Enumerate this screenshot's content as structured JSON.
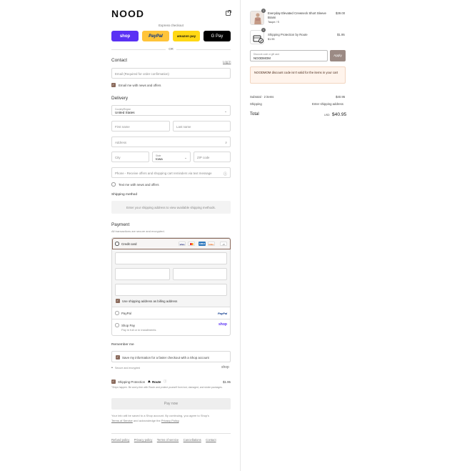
{
  "brand": {
    "logo": "NOOD"
  },
  "express": {
    "label": "Express checkout",
    "buttons": [
      {
        "label": "shop",
        "color": "#5a31f4",
        "text_color": "#ffffff"
      },
      {
        "label": "PayPal",
        "color": "#ffc439",
        "text_color": "#003087"
      },
      {
        "label": "amazon pay",
        "color": "#ffd814",
        "text_color": "#111111"
      },
      {
        "label": "G Pay",
        "color": "#000000",
        "text_color": "#ffffff"
      }
    ],
    "or_label": "OR"
  },
  "contact": {
    "heading": "Contact",
    "login_link": "Log in",
    "email_placeholder": "Email (Required for order confirmation)",
    "news_checkbox_label": "Email me with news and offers"
  },
  "delivery": {
    "heading": "Delivery",
    "country_label": "Country/Region",
    "country_value": "United States",
    "first_name_placeholder": "First name",
    "last_name_placeholder": "Last name",
    "address_placeholder": "Address",
    "city_placeholder": "City",
    "state_label": "State",
    "state_value": "Iowa",
    "zip_placeholder": "ZIP code",
    "phone_placeholder": "Phone - Receive offers and shopping cart reminders via text message",
    "text_checkbox_label": "Text me with news and offers"
  },
  "shipping_method": {
    "heading": "Shipping method",
    "message": "Enter your shipping address to view available shipping methods."
  },
  "payment": {
    "heading": "Payment",
    "subtitle": "All transactions are secure and encrypted.",
    "credit_card_label": "Credit card",
    "card_brands": [
      "VISA",
      "MC",
      "AMEX",
      "DISC"
    ],
    "more_cards": "+5",
    "billing_checkbox_label": "Use shipping address as billing address",
    "paypal_label": "PayPal",
    "paypal_logo": "PayPal",
    "shoppay_label": "Shop Pay",
    "shoppay_sub": "Pay in full or in installments",
    "shoppay_logo": "shop"
  },
  "remember": {
    "heading": "Remember me",
    "checkbox_label": "Save my information for a faster checkout with a Shop account",
    "secure_label": "Secure and encrypted",
    "shop_logo": "shop"
  },
  "protection": {
    "label": "Shipping Protection",
    "route_label": "Route",
    "price": "$1.95",
    "description": "\"Ships happen. Be worry-free with Route and protect yourself from lost, damaged, and stolen packages."
  },
  "pay_now_label": "Pay now",
  "legal": {
    "line1": "Your info will be saved to a Shop account. By continuing, you agree to Shop's",
    "terms_link": "Terms of Service",
    "middle": "and acknowledge the",
    "privacy_link": "Privacy Policy",
    "end": "."
  },
  "footer_links": [
    "Refund policy",
    "Privacy policy",
    "Terms of service",
    "Cancellations",
    "Contact"
  ],
  "summary": {
    "items": [
      {
        "qty": "1",
        "name": "Everyday Elevated Crewneck Short Sleeve Brami",
        "variant": "Taupe / S",
        "price": "$39.00"
      },
      {
        "qty": "1",
        "name": "Shipping Protection by Route",
        "variant": "$1.95",
        "price": "$1.95"
      }
    ],
    "discount_label": "Discount code or gift card",
    "discount_value": "NOODMOM",
    "apply_label": "Apply",
    "error_message": "NOODMOM discount code isn't valid for the items in your cart",
    "subtotal_label": "Subtotal · 2 items",
    "subtotal_value": "$40.95",
    "shipping_label": "Shipping",
    "shipping_value": "Enter shipping address",
    "total_label": "Total",
    "currency": "USD",
    "total_value": "$40.95",
    "colors": {
      "accent": "#8a6a5c",
      "error_bg": "#fff4ec",
      "apply_bg": "#9b8a84"
    }
  }
}
